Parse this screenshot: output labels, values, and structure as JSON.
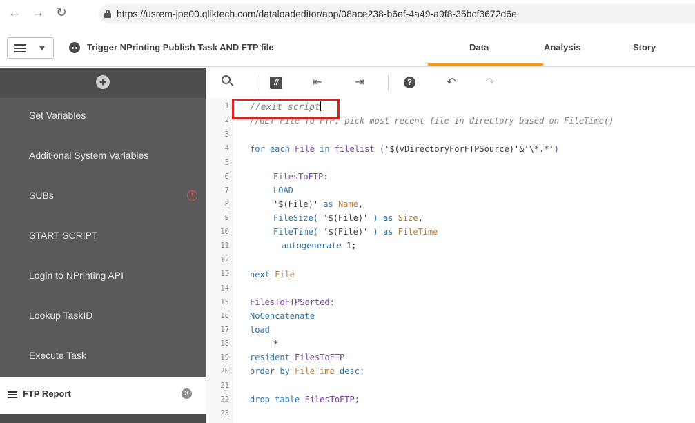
{
  "browser": {
    "url": "https://usrem-jpe00.qliktech.com/dataloadeditor/app/08ace238-b6ef-4a49-a9f8-35bcf3672d6e",
    "back_icon": "arrow-left-icon",
    "forward_icon": "arrow-right-icon",
    "reload_icon": "reload-icon"
  },
  "header": {
    "app_title": "Trigger NPrinting Publish Task AND FTP file",
    "tabs": [
      {
        "label": "Data",
        "active": true
      },
      {
        "label": "Analysis",
        "active": false
      },
      {
        "label": "Story",
        "active": false
      }
    ],
    "accent_color": "#f39c12"
  },
  "sidebar": {
    "add_icon": "plus-circle-icon",
    "items": [
      {
        "label": "Set Variables"
      },
      {
        "label": "Additional System Variables"
      },
      {
        "label": "SUBs",
        "warning": true
      },
      {
        "label": "START SCRIPT"
      },
      {
        "label": "Login to NPrinting API"
      },
      {
        "label": "Lookup TaskID"
      },
      {
        "label": "Execute Task"
      }
    ],
    "active_item": {
      "label": "FTP Report"
    }
  },
  "toolbar": {
    "search_icon": "search-icon",
    "comment_label": "//",
    "indent_icon": "indent-icon",
    "outdent_icon": "outdent-icon",
    "help_label": "?",
    "undo_icon": "undo-icon",
    "redo_icon": "redo-icon"
  },
  "editor": {
    "line_numbers": [
      "1",
      "2",
      "3",
      "4",
      "5",
      "6",
      "7",
      "8",
      "9",
      "10",
      "11",
      "12",
      "13",
      "14",
      "15",
      "16",
      "17",
      "18",
      "19",
      "20",
      "21",
      "22",
      "23"
    ],
    "code": {
      "l1": "//exit script",
      "l2": "//GET File To FTP, pick most recent file in directory based on FileTime()",
      "l4_kw": "for each",
      "l4_a": " File ",
      "l4_in": "in",
      "l4_b": " filelist (",
      "l4_str": "'$(vDirectoryForFTPSource)'&'\\*.*'",
      "l4_c": ")",
      "l6": "FilesToFTP:",
      "l7": "LOAD",
      "l8_str": "'$(File)'",
      "l8_as": " as ",
      "l8_f": "Name",
      "l8_end": ",",
      "l9_fn": "FileSize(",
      "l9_str": " '$(File)' ",
      "l9_c": ") ",
      "l9_as": "as ",
      "l9_f": "Size",
      "l9_end": ",",
      "l10_fn": "FileTime(",
      "l10_str": " '$(File)' ",
      "l10_c": ") ",
      "l10_as": "as ",
      "l10_f": "FileTime",
      "l11_kw": "autogenerate",
      "l11_rest": " 1;",
      "l13_kw": "next",
      "l13_f": " File",
      "l15": "FilesToFTPSorted:",
      "l16": "NoConcatenate",
      "l17": "load",
      "l18": "*",
      "l19_kw": "resident",
      "l19_rest": " FilesToFTP",
      "l20_kw": "order by",
      "l20_f": " FileTime",
      "l20_rest": " desc;",
      "l22_kw": "drop table",
      "l22_rest": " FilesToFTP;"
    },
    "highlight_color": "#e0201f"
  }
}
